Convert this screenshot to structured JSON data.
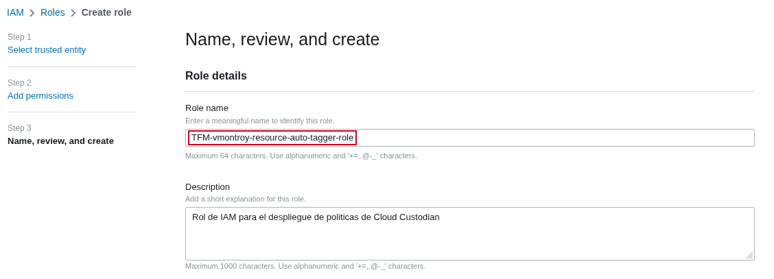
{
  "breadcrumb": [
    {
      "label": "IAM",
      "kind": "link"
    },
    {
      "label": "Roles",
      "kind": "link"
    },
    {
      "label": "Create role",
      "kind": "current"
    }
  ],
  "steps": [
    {
      "step": "Step 1",
      "label": "Select trusted entity",
      "selected": false
    },
    {
      "step": "Step 2",
      "label": "Add permissions",
      "selected": false
    },
    {
      "step": "Step 3",
      "label": "Name, review, and create",
      "selected": true
    }
  ],
  "title": "Name, review, and create",
  "section": "Role details",
  "role_name": {
    "label": "Role name",
    "hint": "Enter a meaningful name to identify this role.",
    "value": "TFM-vmontroy-resource-auto-tagger-role",
    "highlighted": true,
    "constraint": "Maximum 64 characters. Use alphanumeric and '+=,.@-_' characters."
  },
  "description": {
    "label": "Description",
    "hint": "Add a short explanation for this role.",
    "value": "Rol de IAM para el despliegue de politicas de Cloud Custodian",
    "constraint": "Maximum 1000 characters. Use alphanumeric and '+=,.@-_' characters."
  }
}
